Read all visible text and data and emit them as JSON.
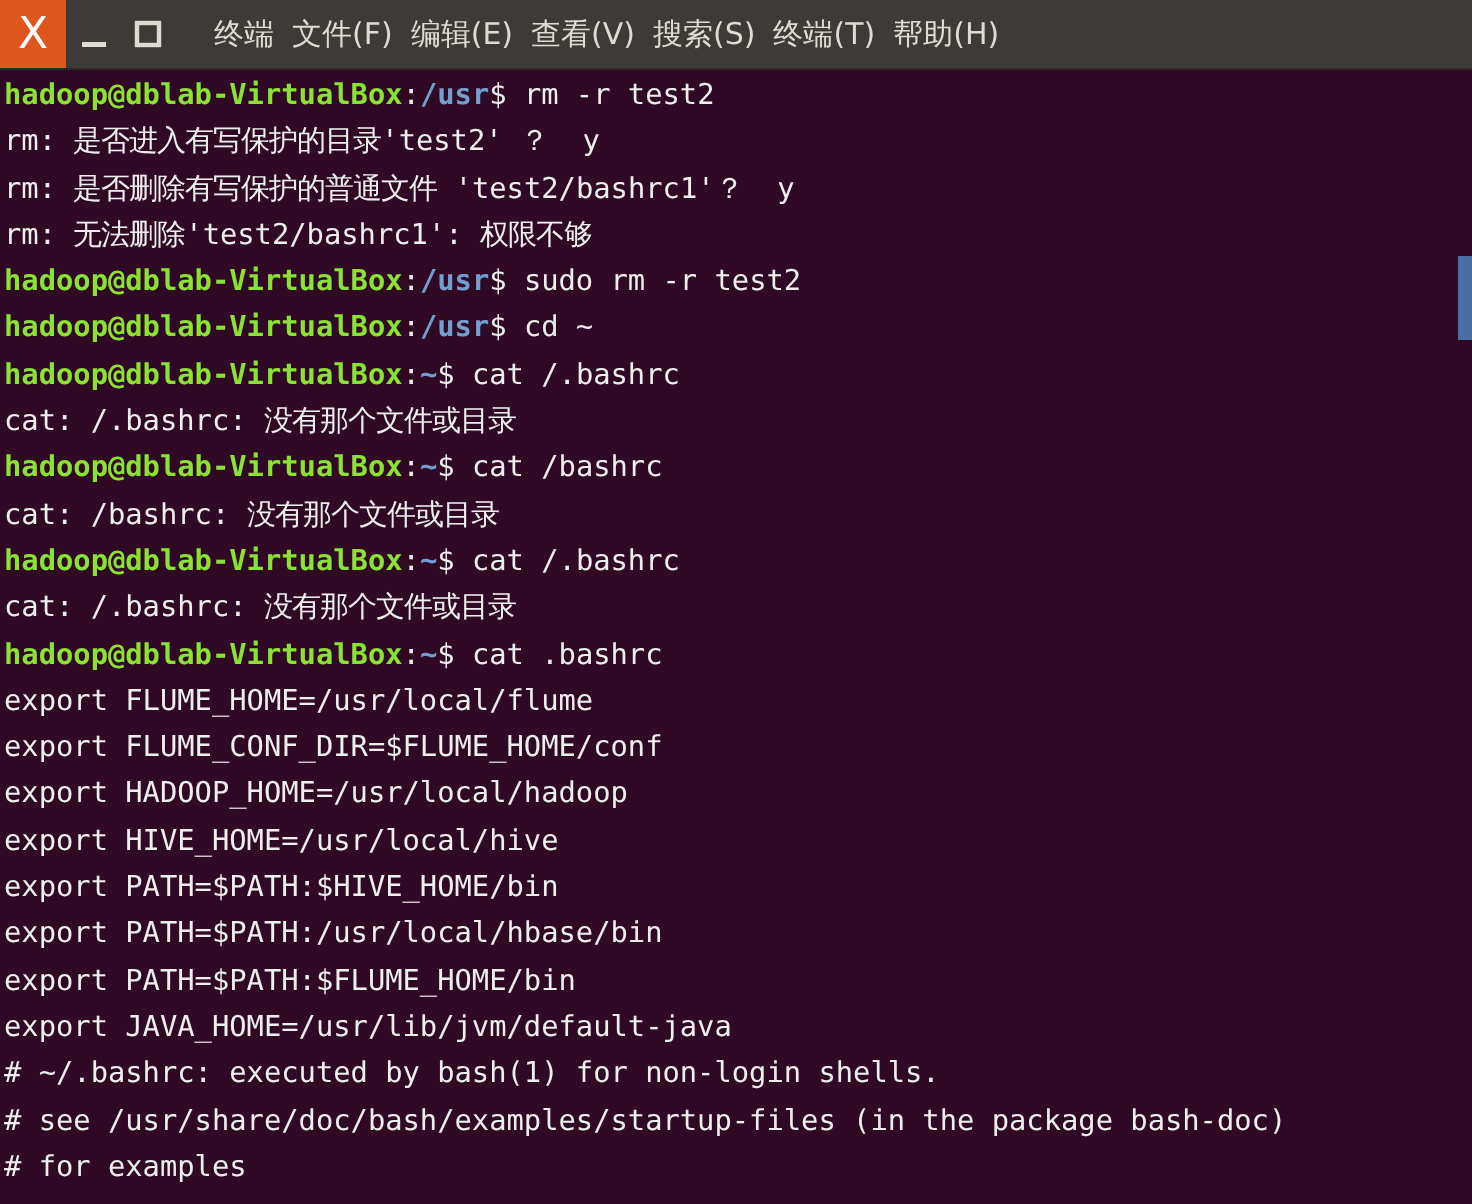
{
  "window": {
    "controls": [
      "X"
    ]
  },
  "menu": [
    "终端",
    "文件(F)",
    "编辑(E)",
    "查看(V)",
    "搜索(S)",
    "终端(T)",
    "帮助(H)"
  ],
  "lines": [
    {
      "kind": "prompt",
      "user": "hadoop@dblab-VirtualBox",
      "sep": ":",
      "path": "/usr",
      "symbol": "$",
      "command": " rm -r test2"
    },
    {
      "kind": "output",
      "text": "rm: 是否进入有写保护的目录'test2' ？  y"
    },
    {
      "kind": "output",
      "text": "rm: 是否删除有写保护的普通文件 'test2/bashrc1'？  y"
    },
    {
      "kind": "output",
      "text": "rm: 无法删除'test2/bashrc1': 权限不够"
    },
    {
      "kind": "prompt",
      "user": "hadoop@dblab-VirtualBox",
      "sep": ":",
      "path": "/usr",
      "symbol": "$",
      "command": " sudo rm -r test2"
    },
    {
      "kind": "prompt",
      "user": "hadoop@dblab-VirtualBox",
      "sep": ":",
      "path": "/usr",
      "symbol": "$",
      "command": " cd ~"
    },
    {
      "kind": "prompt",
      "user": "hadoop@dblab-VirtualBox",
      "sep": ":",
      "path": "~",
      "symbol": "$",
      "command": " cat /.bashrc"
    },
    {
      "kind": "output",
      "text": "cat: /.bashrc: 没有那个文件或目录"
    },
    {
      "kind": "prompt",
      "user": "hadoop@dblab-VirtualBox",
      "sep": ":",
      "path": "~",
      "symbol": "$",
      "command": " cat /bashrc"
    },
    {
      "kind": "output",
      "text": "cat: /bashrc: 没有那个文件或目录"
    },
    {
      "kind": "prompt",
      "user": "hadoop@dblab-VirtualBox",
      "sep": ":",
      "path": "~",
      "symbol": "$",
      "command": " cat /.bashrc"
    },
    {
      "kind": "output",
      "text": "cat: /.bashrc: 没有那个文件或目录"
    },
    {
      "kind": "prompt",
      "user": "hadoop@dblab-VirtualBox",
      "sep": ":",
      "path": "~",
      "symbol": "$",
      "command": " cat .bashrc"
    },
    {
      "kind": "output",
      "text": "export FLUME_HOME=/usr/local/flume"
    },
    {
      "kind": "output",
      "text": "export FLUME_CONF_DIR=$FLUME_HOME/conf"
    },
    {
      "kind": "output",
      "text": "export HADOOP_HOME=/usr/local/hadoop"
    },
    {
      "kind": "output",
      "text": "export HIVE_HOME=/usr/local/hive"
    },
    {
      "kind": "output",
      "text": "export PATH=$PATH:$HIVE_HOME/bin"
    },
    {
      "kind": "output",
      "text": "export PATH=$PATH:/usr/local/hbase/bin"
    },
    {
      "kind": "output",
      "text": "export PATH=$PATH:$FLUME_HOME/bin"
    },
    {
      "kind": "output",
      "text": "export JAVA_HOME=/usr/lib/jvm/default-java"
    },
    {
      "kind": "output",
      "text": "# ~/.bashrc: executed by bash(1) for non-login shells."
    },
    {
      "kind": "output",
      "text": "# see /usr/share/doc/bash/examples/startup-files (in the package bash-doc)"
    },
    {
      "kind": "output",
      "text": "# for examples"
    }
  ]
}
